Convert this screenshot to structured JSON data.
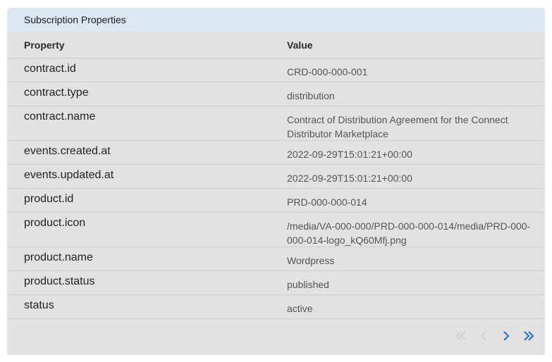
{
  "panel": {
    "title": "Subscription Properties"
  },
  "table": {
    "headers": {
      "property": "Property",
      "value": "Value"
    },
    "rows": [
      {
        "property": "contract.id",
        "value": "CRD-000-000-001"
      },
      {
        "property": "contract.type",
        "value": "distribution"
      },
      {
        "property": "contract.name",
        "value": "Contract of Distribution Agreement for the Connect Distributor Marketplace"
      },
      {
        "property": "events.created.at",
        "value": "2022-09-29T15:01:21+00:00"
      },
      {
        "property": "events.updated.at",
        "value": "2022-09-29T15:01:21+00:00"
      },
      {
        "property": "product.id",
        "value": "PRD-000-000-014"
      },
      {
        "property": "product.icon",
        "value": "/media/VA-000-000/PRD-000-000-014/media/PRD-000-000-014-logo_kQ60Mfj.png"
      },
      {
        "property": "product.name",
        "value": "Wordpress"
      },
      {
        "property": "product.status",
        "value": "published"
      },
      {
        "property": "status",
        "value": "active"
      }
    ]
  },
  "pagination": {
    "icons": [
      "first-page-icon",
      "prev-page-icon",
      "next-page-icon",
      "last-page-icon"
    ],
    "active_color": "#1e6fd1",
    "disabled_color": "#cfcfcf"
  }
}
